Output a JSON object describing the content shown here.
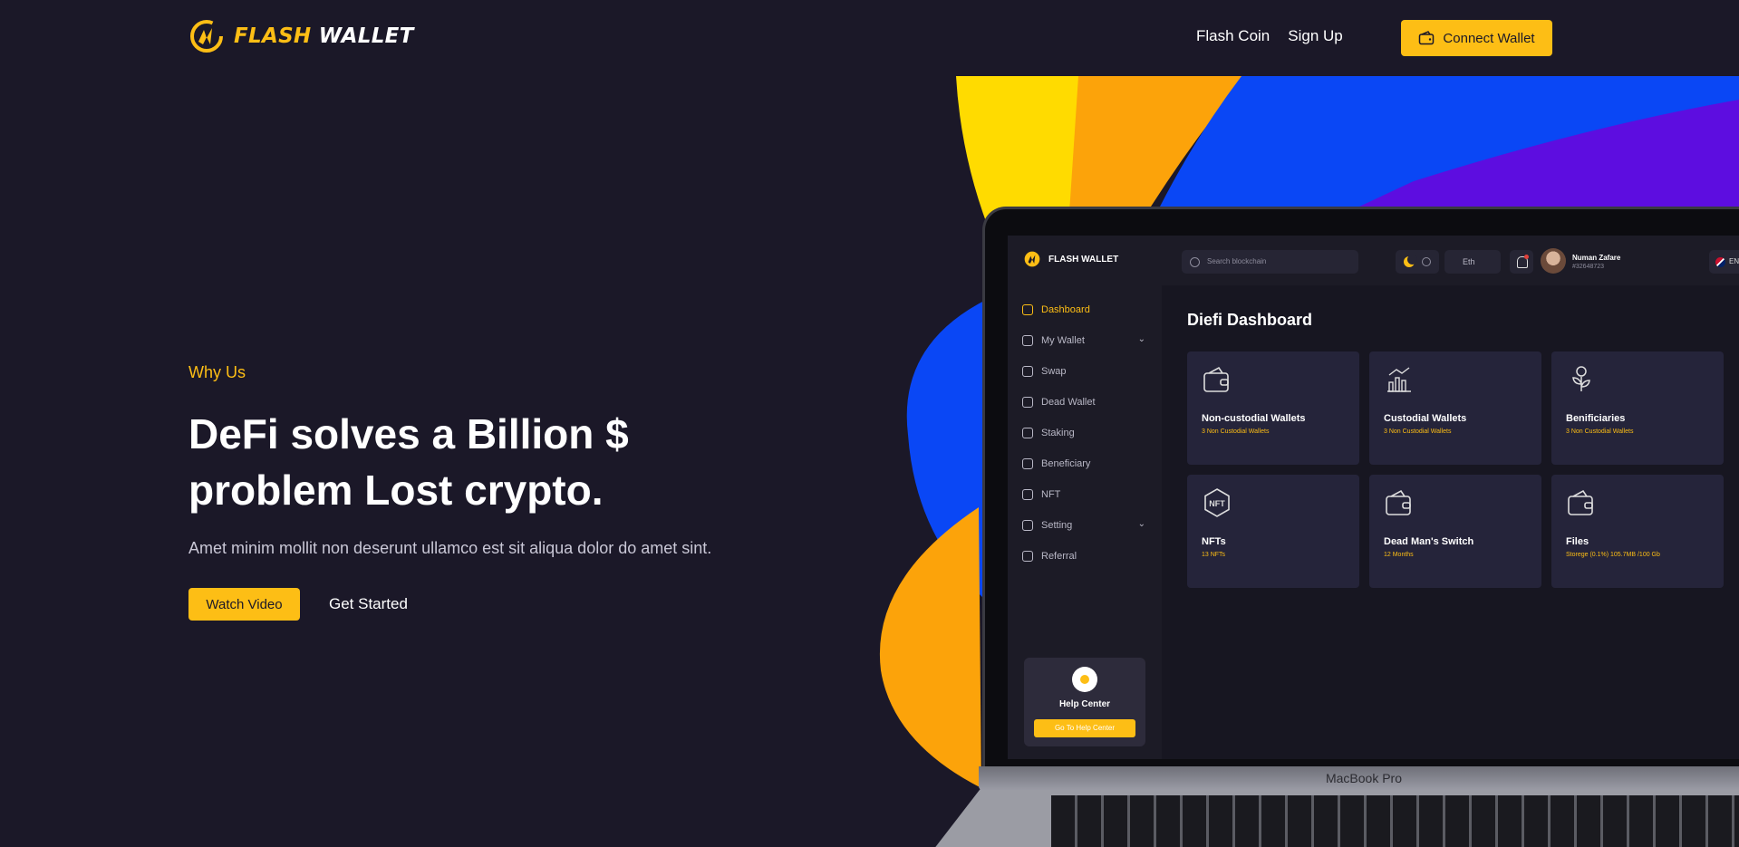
{
  "header": {
    "brand_word1": "FLASH",
    "brand_word2": "WALLET",
    "nav": [
      "Flash Coin",
      "Sign Up"
    ],
    "connect_label": "Connect Wallet"
  },
  "hero": {
    "eyebrow": "Why Us",
    "headline_line1": "DeFi solves a Billion $",
    "headline_line2": "problem Lost crypto.",
    "subtitle": "Amet minim mollit non deserunt ullamco est sit aliqua dolor do amet sint.",
    "watch_label": "Watch Video",
    "started_label": "Get Started"
  },
  "laptop": {
    "model_label": "MacBook Pro"
  },
  "dashboard": {
    "brand": "FLASH WALLET",
    "search_placeholder": "Search blockchain",
    "network": "Eth",
    "user_name": "Numan Zafare",
    "user_id": "#32648723",
    "language": "ENG",
    "title": "Diefi Dashboard",
    "menu": [
      {
        "label": "Dashboard",
        "active": true
      },
      {
        "label": "My Wallet",
        "has_children": true
      },
      {
        "label": "Swap"
      },
      {
        "label": "Dead Wallet"
      },
      {
        "label": "Staking"
      },
      {
        "label": "Beneficiary"
      },
      {
        "label": "NFT"
      },
      {
        "label": "Setting",
        "has_children": true
      },
      {
        "label": "Referral"
      }
    ],
    "help_title": "Help Center",
    "help_button": "Go To Help Center",
    "cards": [
      {
        "title": "Non-custodial Wallets",
        "sub": "3 Non Custodial Wallets",
        "icon": "wallet-icon"
      },
      {
        "title": "Custodial Wallets",
        "sub": "3 Non Custodial Wallets",
        "icon": "chart-icon"
      },
      {
        "title": "Benificiaries",
        "sub": "3 Non Custodial Wallets",
        "icon": "plant-coin-icon"
      },
      {
        "title": "NFTs",
        "sub": "13 NFTs",
        "icon": "nft-icon"
      },
      {
        "title": "Dead Man's Switch",
        "sub": "12 Months",
        "icon": "wallet-icon"
      },
      {
        "title": "Files",
        "sub": "Storege (0.1%) 105.7MB /100 Gb",
        "icon": "wallet-icon"
      }
    ]
  },
  "colors": {
    "background": "#1b1828",
    "accent": "#fdbe15",
    "blue": "#0a47f5",
    "orange": "#fca30a",
    "purple": "#5d0de0"
  }
}
